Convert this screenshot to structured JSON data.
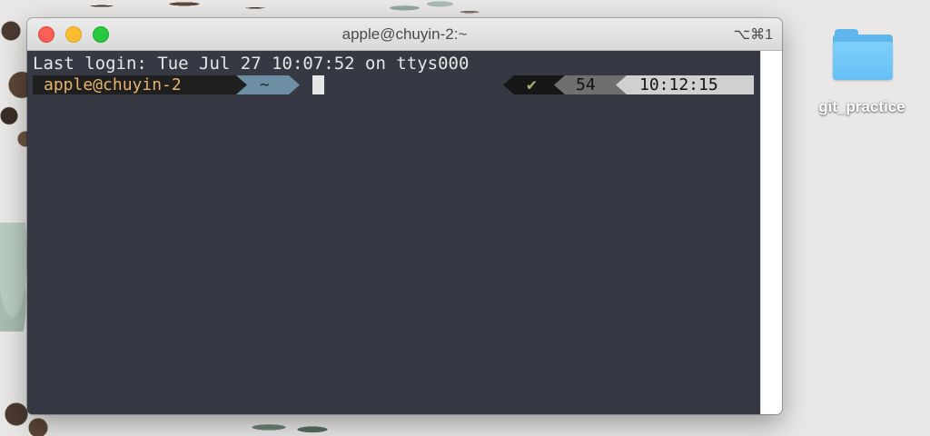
{
  "window": {
    "title": "apple@chuyin-2:~",
    "shortcut": "⌥⌘1"
  },
  "terminal": {
    "last_login": "Last login: Tue Jul 27 10:07:52 on ttys000",
    "prompt": {
      "user_host": "apple@chuyin-2",
      "directory": "~",
      "status_icon": "✔",
      "history_count": "54",
      "time": "10:12:15"
    }
  },
  "desktop": {
    "folder_label": "git_practice"
  },
  "colors": {
    "terminal_bg": "#363944",
    "user_segment_fg": "#e9b46a",
    "dir_segment_bg": "#6e8ea3",
    "status_check": "#9dba6a",
    "folder_blue": "#66c0f5"
  }
}
